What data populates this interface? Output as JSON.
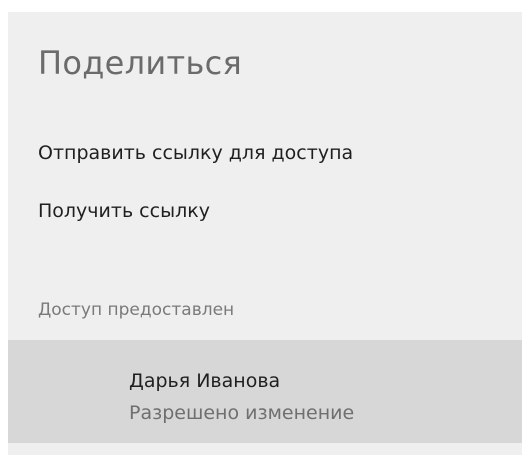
{
  "share_panel": {
    "title": "Поделиться",
    "actions": {
      "send_link": "Отправить ссылку для доступа",
      "get_link": "Получить ссылку"
    },
    "shared_section": {
      "label": "Доступ предоставлен",
      "users": [
        {
          "name": "Дарья Иванова",
          "permission": "Разрешено изменение"
        }
      ]
    }
  },
  "colors": {
    "panel_background": "#efefef",
    "selected_row_background": "#d7d7d7",
    "title_text": "#6b6b6b",
    "primary_text": "#1f1f1f",
    "secondary_text": "#7a7a7a"
  }
}
